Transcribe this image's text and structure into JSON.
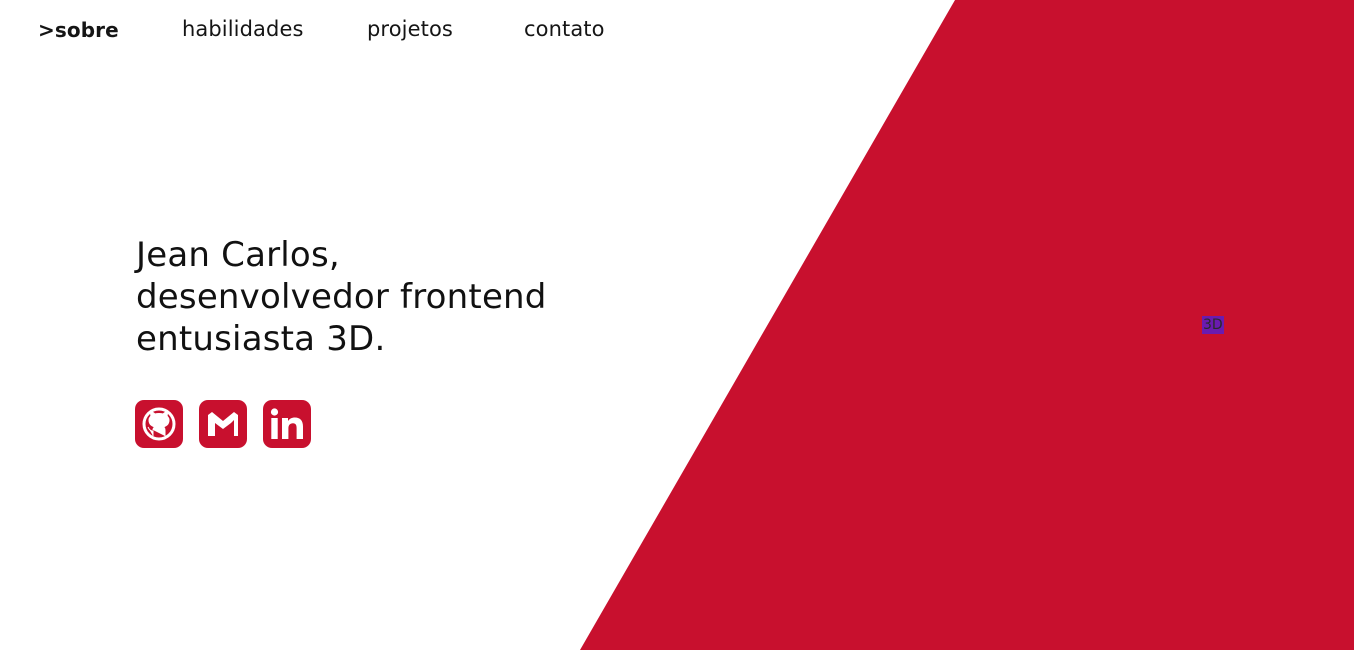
{
  "nav": {
    "items": [
      {
        "label": ">sobre",
        "active": true
      },
      {
        "label": "habilidades",
        "active": false
      },
      {
        "label": "projetos",
        "active": false
      },
      {
        "label": "contato",
        "active": false
      }
    ]
  },
  "hero": {
    "lines": [
      "Jean Carlos,",
      "desenvolvedor frontend",
      "entusiasta 3D."
    ]
  },
  "socials": [
    {
      "icon": "github-icon"
    },
    {
      "icon": "gmail-icon"
    },
    {
      "icon": "linkedin-icon"
    }
  ],
  "canvas_placeholder": {
    "label": "3D"
  },
  "colors": {
    "accent": "#c8102e",
    "text": "#111111",
    "background": "#ffffff",
    "placeholder_bg": "#6a1bb0"
  }
}
